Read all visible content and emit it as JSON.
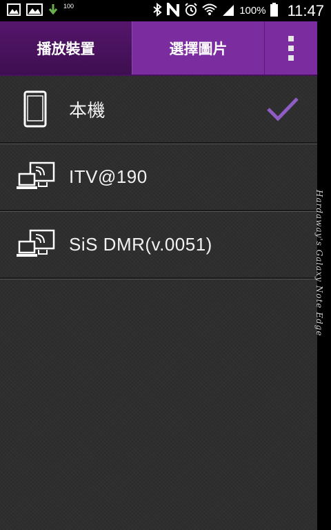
{
  "status_bar": {
    "notif_badge": "100",
    "battery": "100%",
    "time": "11:47"
  },
  "tabs": {
    "playback": "播放裝置",
    "select_image": "選擇圖片"
  },
  "devices": [
    {
      "label": "本機",
      "icon": "phone-icon",
      "selected": true
    },
    {
      "label": "ITV@190",
      "icon": "cast-device-icon",
      "selected": false
    },
    {
      "label": "SiS DMR(v.0051)",
      "icon": "cast-device-icon",
      "selected": false
    }
  ],
  "watermark": "Hardaway's Galaxy Note Edge",
  "colors": {
    "accent": "#7b2da0",
    "check": "#8e5cc2"
  }
}
